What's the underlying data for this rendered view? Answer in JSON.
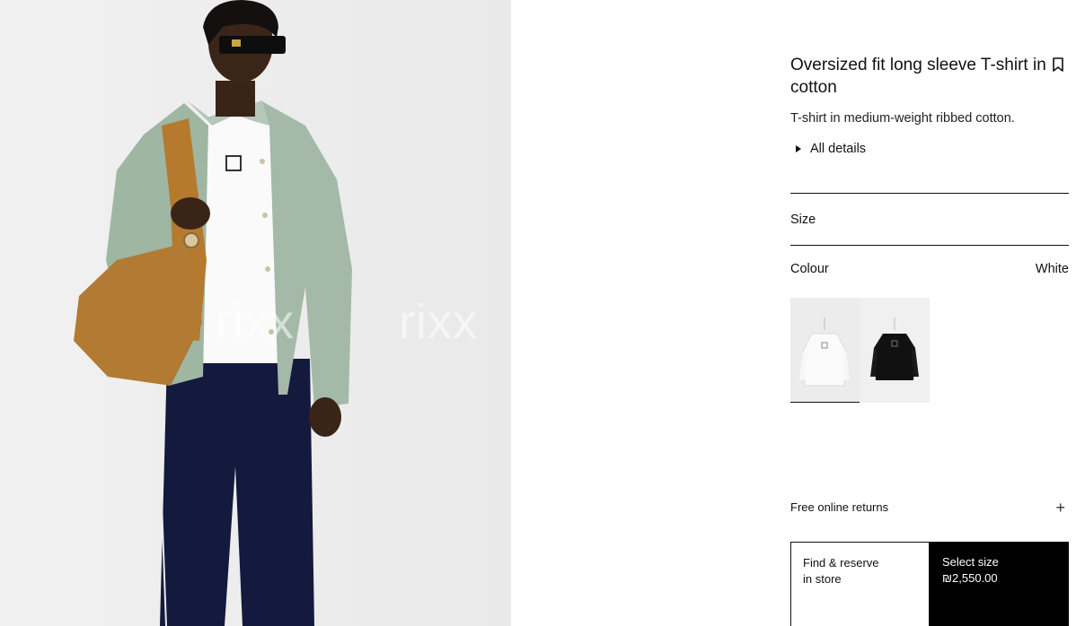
{
  "product": {
    "title": "Oversized fit long sleeve T-shirt in cotton",
    "description": "T-shirt in medium-weight ribbed cotton.",
    "details_label": "All details"
  },
  "options": {
    "size_label": "Size",
    "colour_label": "Colour",
    "colour_value": "White",
    "colours": [
      {
        "name": "White",
        "selected": true
      },
      {
        "name": "Black",
        "selected": false
      }
    ]
  },
  "returns": {
    "label": "Free online returns"
  },
  "cta": {
    "find_line1": "Find & reserve",
    "find_line2": "in store",
    "select_line1": "Select size",
    "price": "₪2,550.00"
  },
  "watermark": {
    "text": "rixx"
  },
  "colors": {
    "accent": "#000000",
    "background": "#ffffff",
    "hero_bg": "#ececec"
  },
  "icons": {
    "bookmark": "bookmark-icon",
    "expand": "plus-icon",
    "disclosure": "triangle-right-icon"
  }
}
